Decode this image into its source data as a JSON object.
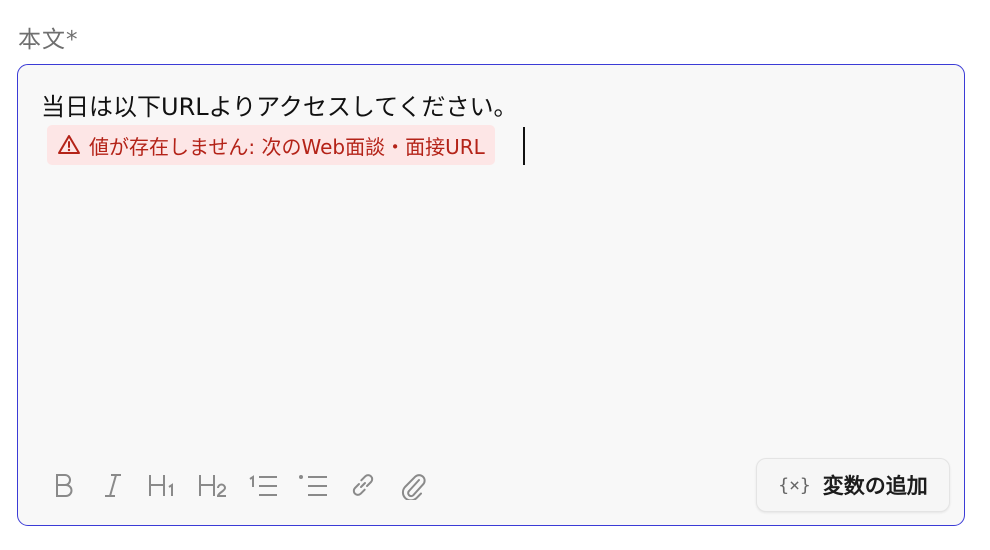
{
  "field": {
    "label": "本文*"
  },
  "editor": {
    "text": "当日は以下URLよりアクセスしてください。",
    "variable_chip": {
      "icon": "warning-triangle-icon",
      "text": "値が存在しません: 次のWeb面談・面接URL",
      "color": "#b42318",
      "background": "#fde6e6"
    }
  },
  "toolbar": {
    "buttons": [
      {
        "name": "bold",
        "icon": "bold-icon"
      },
      {
        "name": "italic",
        "icon": "italic-icon"
      },
      {
        "name": "heading-1",
        "icon": "heading1-icon"
      },
      {
        "name": "heading-2",
        "icon": "heading2-icon"
      },
      {
        "name": "ordered-list",
        "icon": "ordered-list-icon"
      },
      {
        "name": "bullet-list",
        "icon": "bullet-list-icon"
      },
      {
        "name": "link",
        "icon": "link-icon"
      },
      {
        "name": "attachment",
        "icon": "paperclip-icon"
      }
    ],
    "add_variable": {
      "icon": "braces-x-icon",
      "icon_glyph": "{×}",
      "label": "変数の追加"
    }
  },
  "colors": {
    "focus_border": "#3b3bd6",
    "editor_bg": "#f8f8f8",
    "label": "#6f6f6f",
    "icon_gray": "#8a8a8a"
  }
}
